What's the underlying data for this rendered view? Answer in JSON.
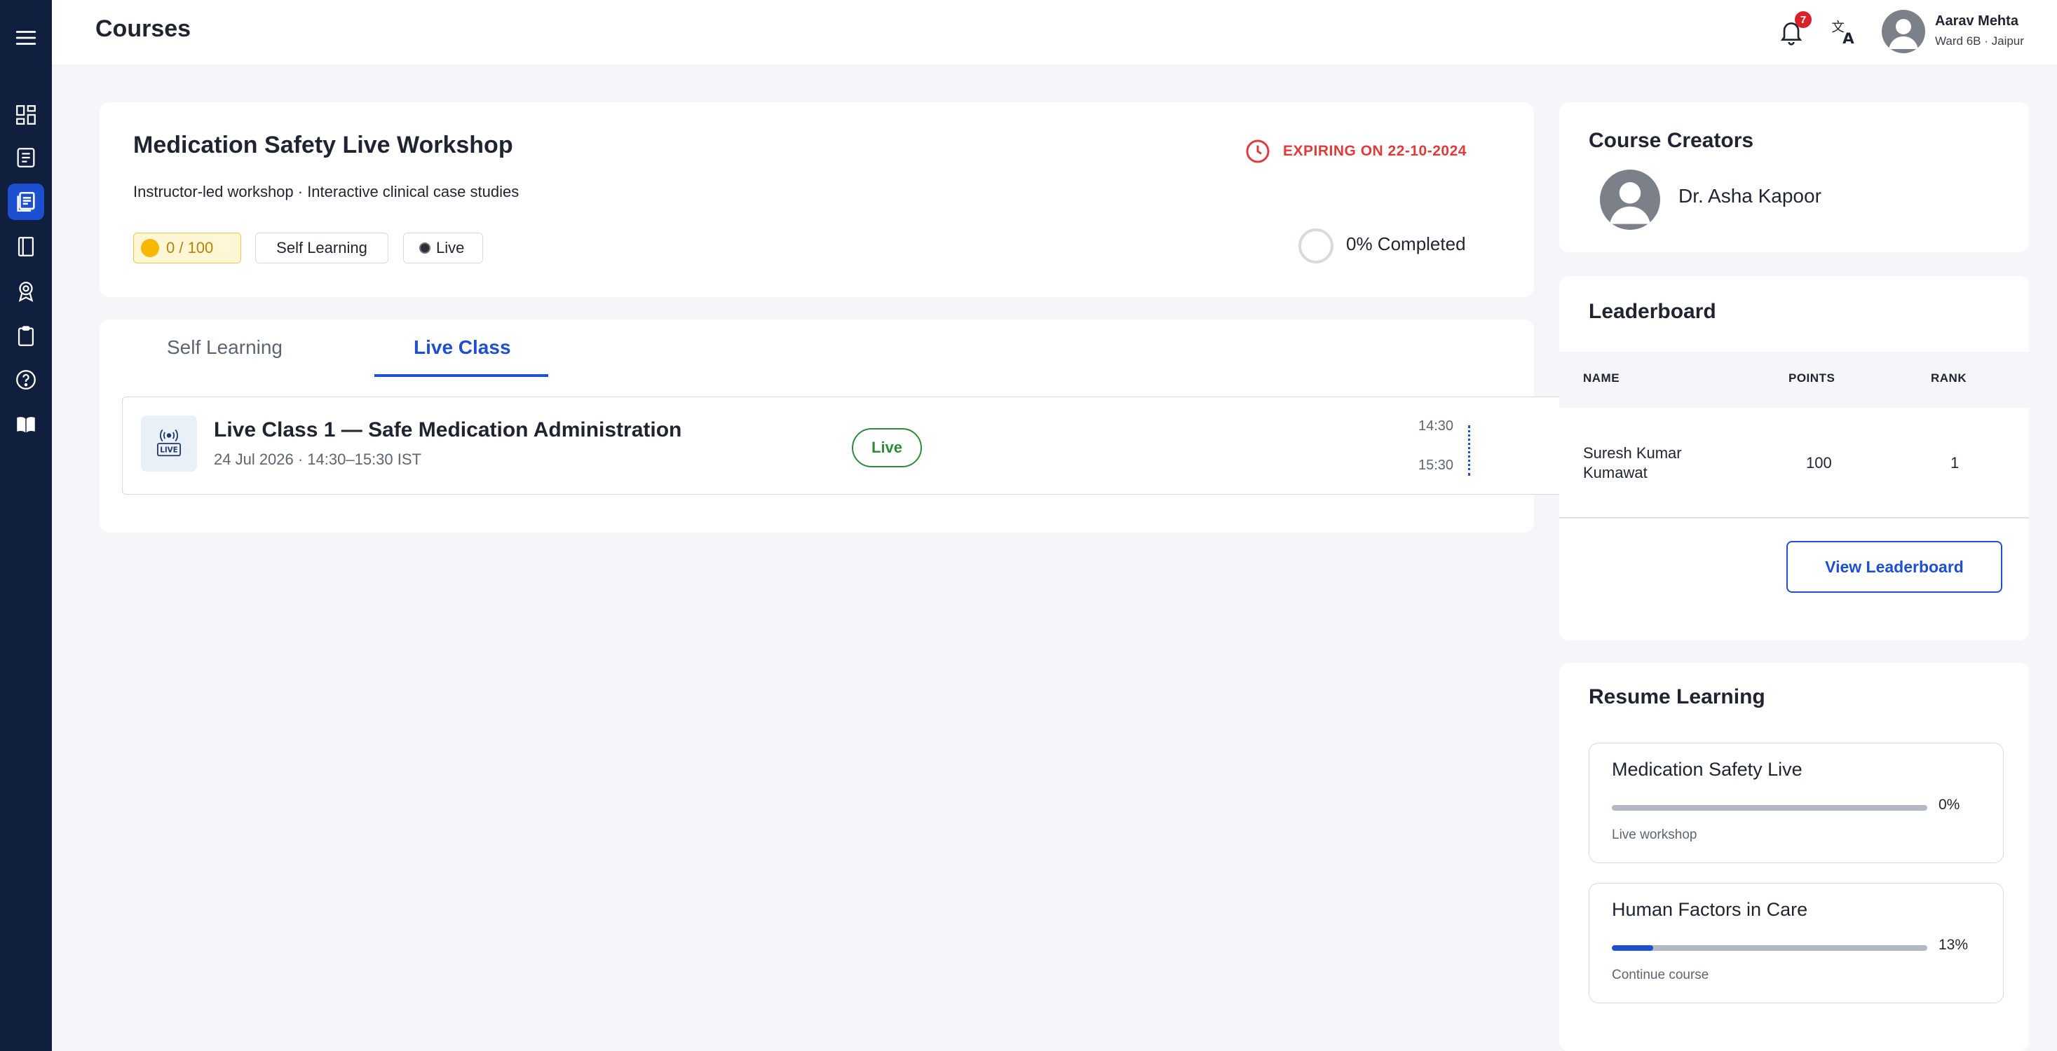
{
  "header": {
    "title": "Courses",
    "notification_count": "7",
    "user_name": "Aarav Mehta",
    "user_ward": "Ward 6B · Jaipur"
  },
  "sidebar": {
    "items": [
      {
        "icon": "menu-icon"
      },
      {
        "icon": "dashboard-icon"
      },
      {
        "icon": "notes-icon"
      },
      {
        "icon": "courses-icon",
        "active": true
      },
      {
        "icon": "book-icon"
      },
      {
        "icon": "award-icon"
      },
      {
        "icon": "clipboard-icon"
      },
      {
        "icon": "help-icon"
      },
      {
        "icon": "library-icon"
      }
    ]
  },
  "course": {
    "title": "Medication Safety Live Workshop",
    "subtitle": "Instructor-led workshop · Interactive clinical case studies",
    "expiry": "EXPIRING ON 22-10-2024",
    "points": "0 / 100",
    "tag_self": "Self Learning",
    "tag_live": "Live",
    "completed": "0% Completed",
    "completion_fraction": 0
  },
  "tabs": {
    "items": [
      "Self Learning",
      "Live Class"
    ],
    "active": "Live Class"
  },
  "live_class": {
    "title": "Live Class 1 — Safe Medication Administration",
    "date": "24 Jul 2026 · 14:30–15:30 IST",
    "status": "Live",
    "start_time": "14:30",
    "end_time": "15:30",
    "icon_text": "LIVE"
  },
  "creators": {
    "title": "Course Creators",
    "name": "Dr. Asha Kapoor"
  },
  "leaderboard": {
    "title": "Leaderboard",
    "columns": [
      "NAME",
      "POINTS",
      "RANK"
    ],
    "rows": [
      {
        "name_line1": "Suresh Kumar",
        "name_line2": "Kumawat",
        "points": "100",
        "rank": "1"
      }
    ],
    "button": "View Leaderboard"
  },
  "resume": {
    "title": "Resume Learning",
    "items": [
      {
        "title": "Medication Safety Live",
        "percent": "0%",
        "progress": 0,
        "subtitle": "Live workshop"
      },
      {
        "title": "Human Factors in Care",
        "percent": "13%",
        "progress": 0.13,
        "subtitle": "Continue course"
      }
    ]
  },
  "colors": {
    "sidebar_bg": "#0f1f3d",
    "accent": "#1d4fd1",
    "danger": "#e03b3b",
    "live_green": "#2e8b3a"
  }
}
